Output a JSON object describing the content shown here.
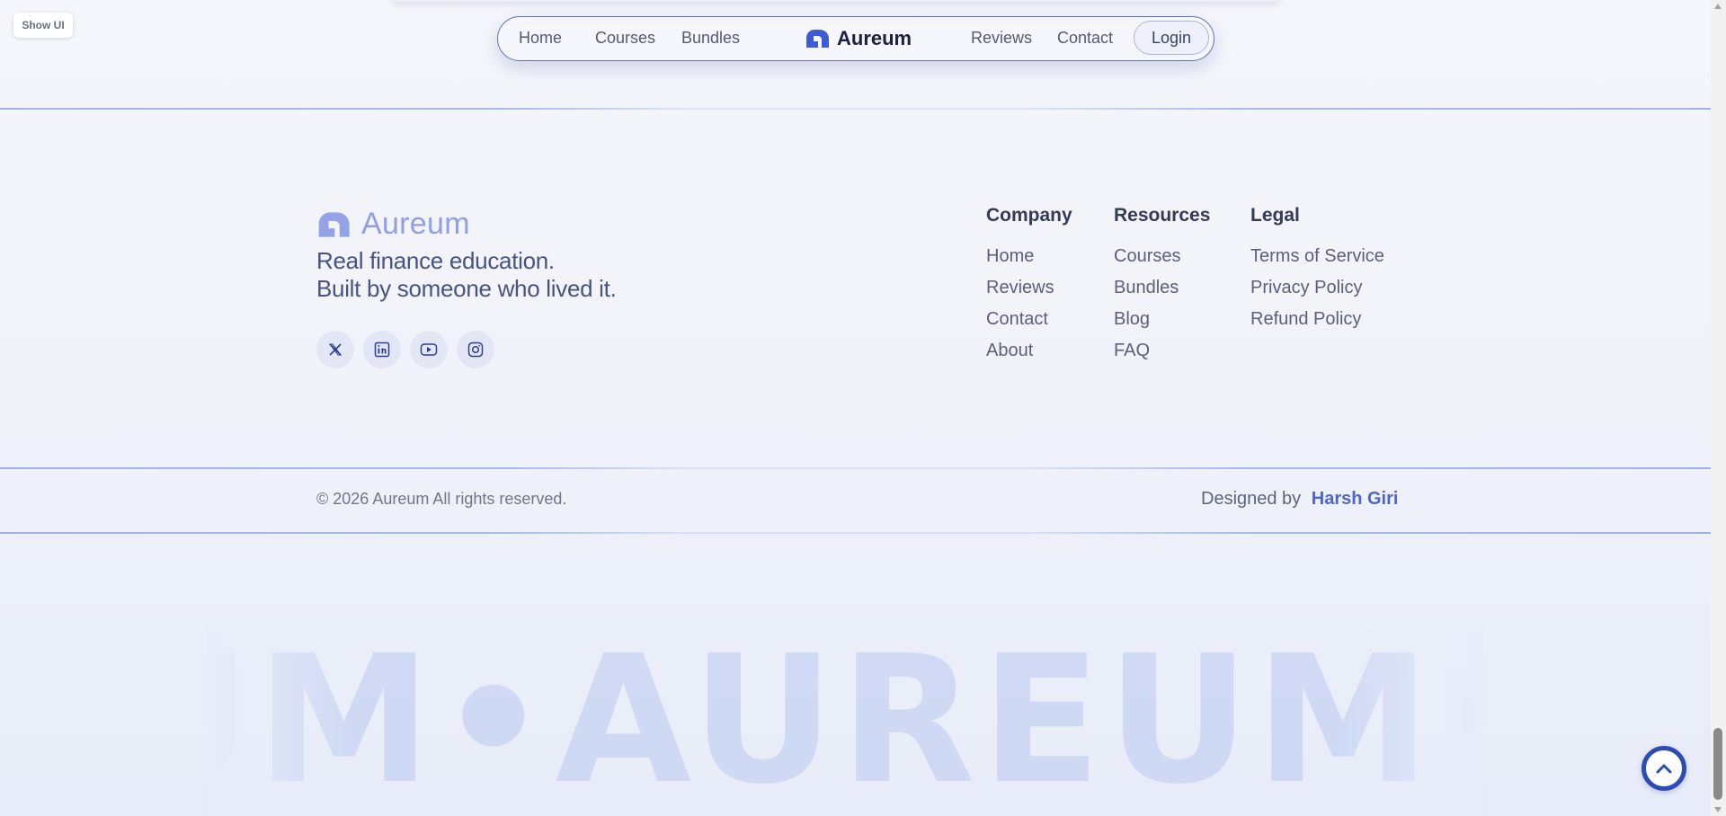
{
  "show_ui_label": "Show UI",
  "nav": {
    "left_links": [
      "Home",
      "Courses",
      "Bundles"
    ],
    "brand": "Aureum",
    "right_links": [
      "Reviews",
      "Contact"
    ],
    "login_label": "Login"
  },
  "footer": {
    "brand": "Aureum",
    "tagline_line1": "Real finance education.",
    "tagline_line2": "Built by someone who lived it.",
    "socials": [
      "x-icon",
      "linkedin-icon",
      "youtube-icon",
      "instagram-icon"
    ],
    "columns": [
      {
        "title": "Company",
        "items": [
          "Home",
          "Reviews",
          "Contact",
          "About"
        ]
      },
      {
        "title": "Resources",
        "items": [
          "Courses",
          "Bundles",
          "Blog",
          "FAQ"
        ]
      },
      {
        "title": "Legal",
        "items": [
          "Terms of Service",
          "Privacy Policy",
          "Refund Policy"
        ]
      }
    ],
    "copyright": "© 2026 Aureum All rights reserved.",
    "designed_by_label": "Designed by",
    "designer_name": "Harsh Giri"
  },
  "watermark_text": "UM•AUREUM•AU",
  "colors": {
    "accent": "#2f4cb5",
    "brand_logo": "#3d5bd4",
    "link_accent": "#4f66c9"
  }
}
